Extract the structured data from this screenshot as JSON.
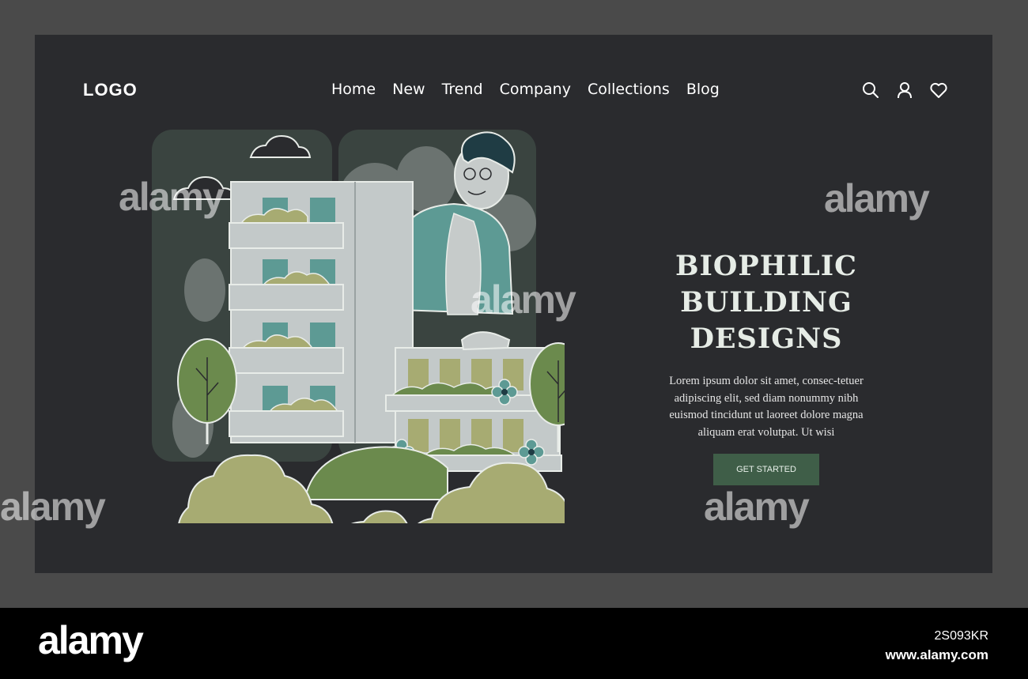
{
  "header": {
    "logo": "LOGO",
    "nav": [
      "Home",
      "New",
      "Trend",
      "Company",
      "Collections",
      "Blog"
    ],
    "icons": [
      "search-icon",
      "user-icon",
      "heart-icon"
    ]
  },
  "hero": {
    "title_line1": "BIOPHILIC",
    "title_line2": "BUILDING DESIGNS",
    "body": "Lorem ipsum dolor sit amet, consec-tetuer adipiscing elit, sed diam nonummy nibh euismod tincidunt ut laoreet dolore magna aliquam erat volutpat. Ut wisi",
    "cta": "GET STARTED"
  },
  "watermark": {
    "text": "alamy"
  },
  "footer": {
    "brand": "alamy",
    "image_id": "2S093KR",
    "url": "www.alamy.com"
  },
  "colors": {
    "panel": "#2a2b2e",
    "frame": "#4a4a4a",
    "cta": "#3f5e48",
    "building": "#c3c9c9",
    "window": "#5d9a94",
    "bush_light": "#a7ab72",
    "bush_dark": "#6b8a4d",
    "jacket": "#5d9a94"
  }
}
